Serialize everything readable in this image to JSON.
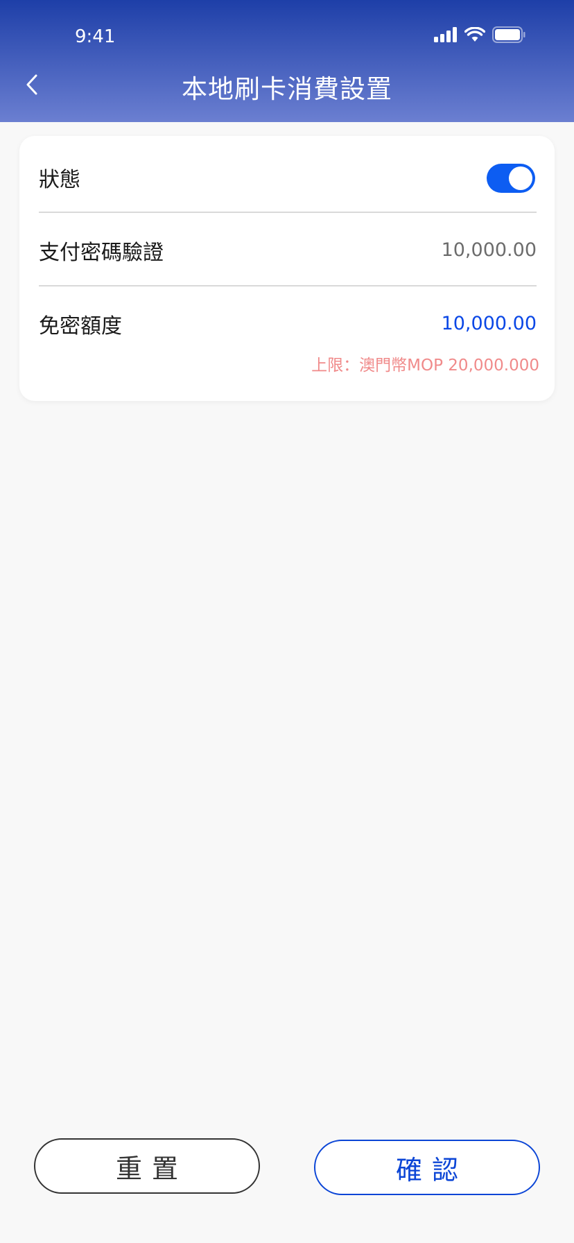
{
  "status_bar": {
    "time": "9:41"
  },
  "header": {
    "title": "本地刷卡消費設置"
  },
  "settings": {
    "status_label": "狀態",
    "status_on": true,
    "password_label": "支付密碼驗證",
    "password_value": "10,000.00",
    "free_label": "免密額度",
    "free_value": "10,000.00",
    "limit_note": "上限：澳門幣MOP 20,000.000"
  },
  "buttons": {
    "reset": "重置",
    "confirm": "確認"
  },
  "colors": {
    "accent": "#0d5df2",
    "header_top": "#1e3fa8",
    "header_bottom": "#6b7fd1",
    "limit_text": "#f08a8a"
  },
  "icons": [
    "chevron-left-icon",
    "signal-icon",
    "wifi-icon",
    "battery-icon"
  ]
}
